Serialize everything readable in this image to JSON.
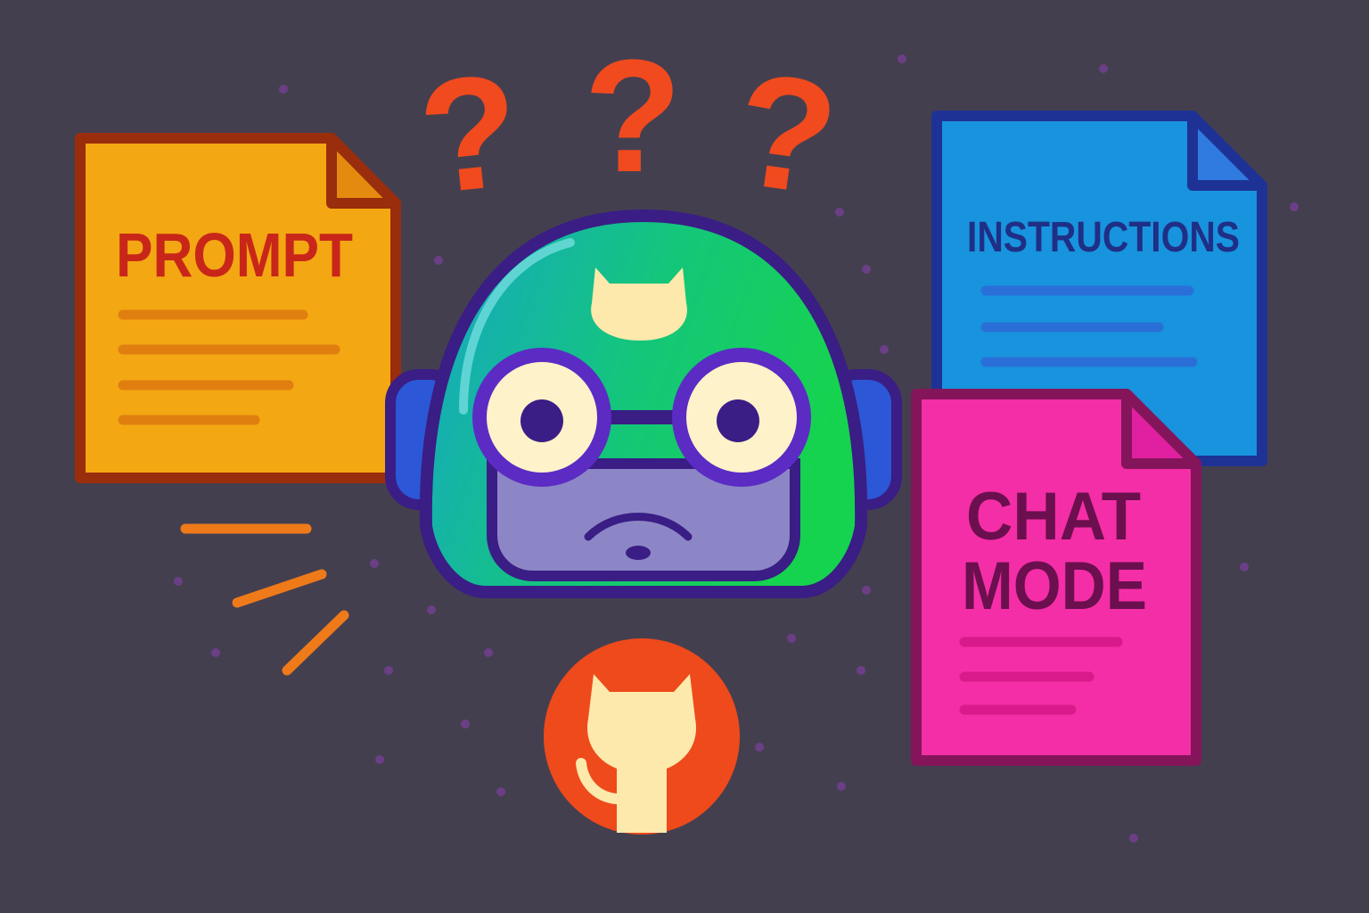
{
  "colors": {
    "background": "#443f4f",
    "question_marks": "#f04a1e",
    "dots": "#6b3f86",
    "motion_lines": "#ef7a1a",
    "prompt_doc_fill": "#f3a712",
    "prompt_doc_border": "#9a2d0c",
    "prompt_text": "#c9261a",
    "instructions_doc_fill": "#1893de",
    "instructions_doc_border": "#1e3296",
    "instructions_text": "#1f2f86",
    "chatmode_doc_fill": "#f42ea6",
    "chatmode_doc_border": "#84155a",
    "chatmode_text": "#6b0f4f",
    "robot_outline": "#3a1d85",
    "robot_helmet_left": "#16a6c8",
    "robot_helmet_right": "#16d34f",
    "robot_ears": "#2c57d6",
    "robot_face": "#8c86c6",
    "robot_eye_white": "#fdf2c9",
    "github_badge": "#ee4a1c",
    "github_cat": "#fde9ab"
  },
  "question_marks": [
    "?",
    "?",
    "?"
  ],
  "documents": {
    "prompt": {
      "title_lines": [
        "PROMPT"
      ],
      "icon": "document-icon"
    },
    "instructions": {
      "title_lines": [
        "INSTRUCTIONS"
      ],
      "icon": "document-icon"
    },
    "chat_mode": {
      "title_lines": [
        "CHAT",
        "MODE"
      ],
      "icon": "document-icon"
    }
  },
  "robot": {
    "icon": "copilot-robot-icon",
    "expression": "confused-frown",
    "helmet_logo": "github-cat-icon"
  },
  "badge": {
    "icon": "github-octocat-icon"
  }
}
